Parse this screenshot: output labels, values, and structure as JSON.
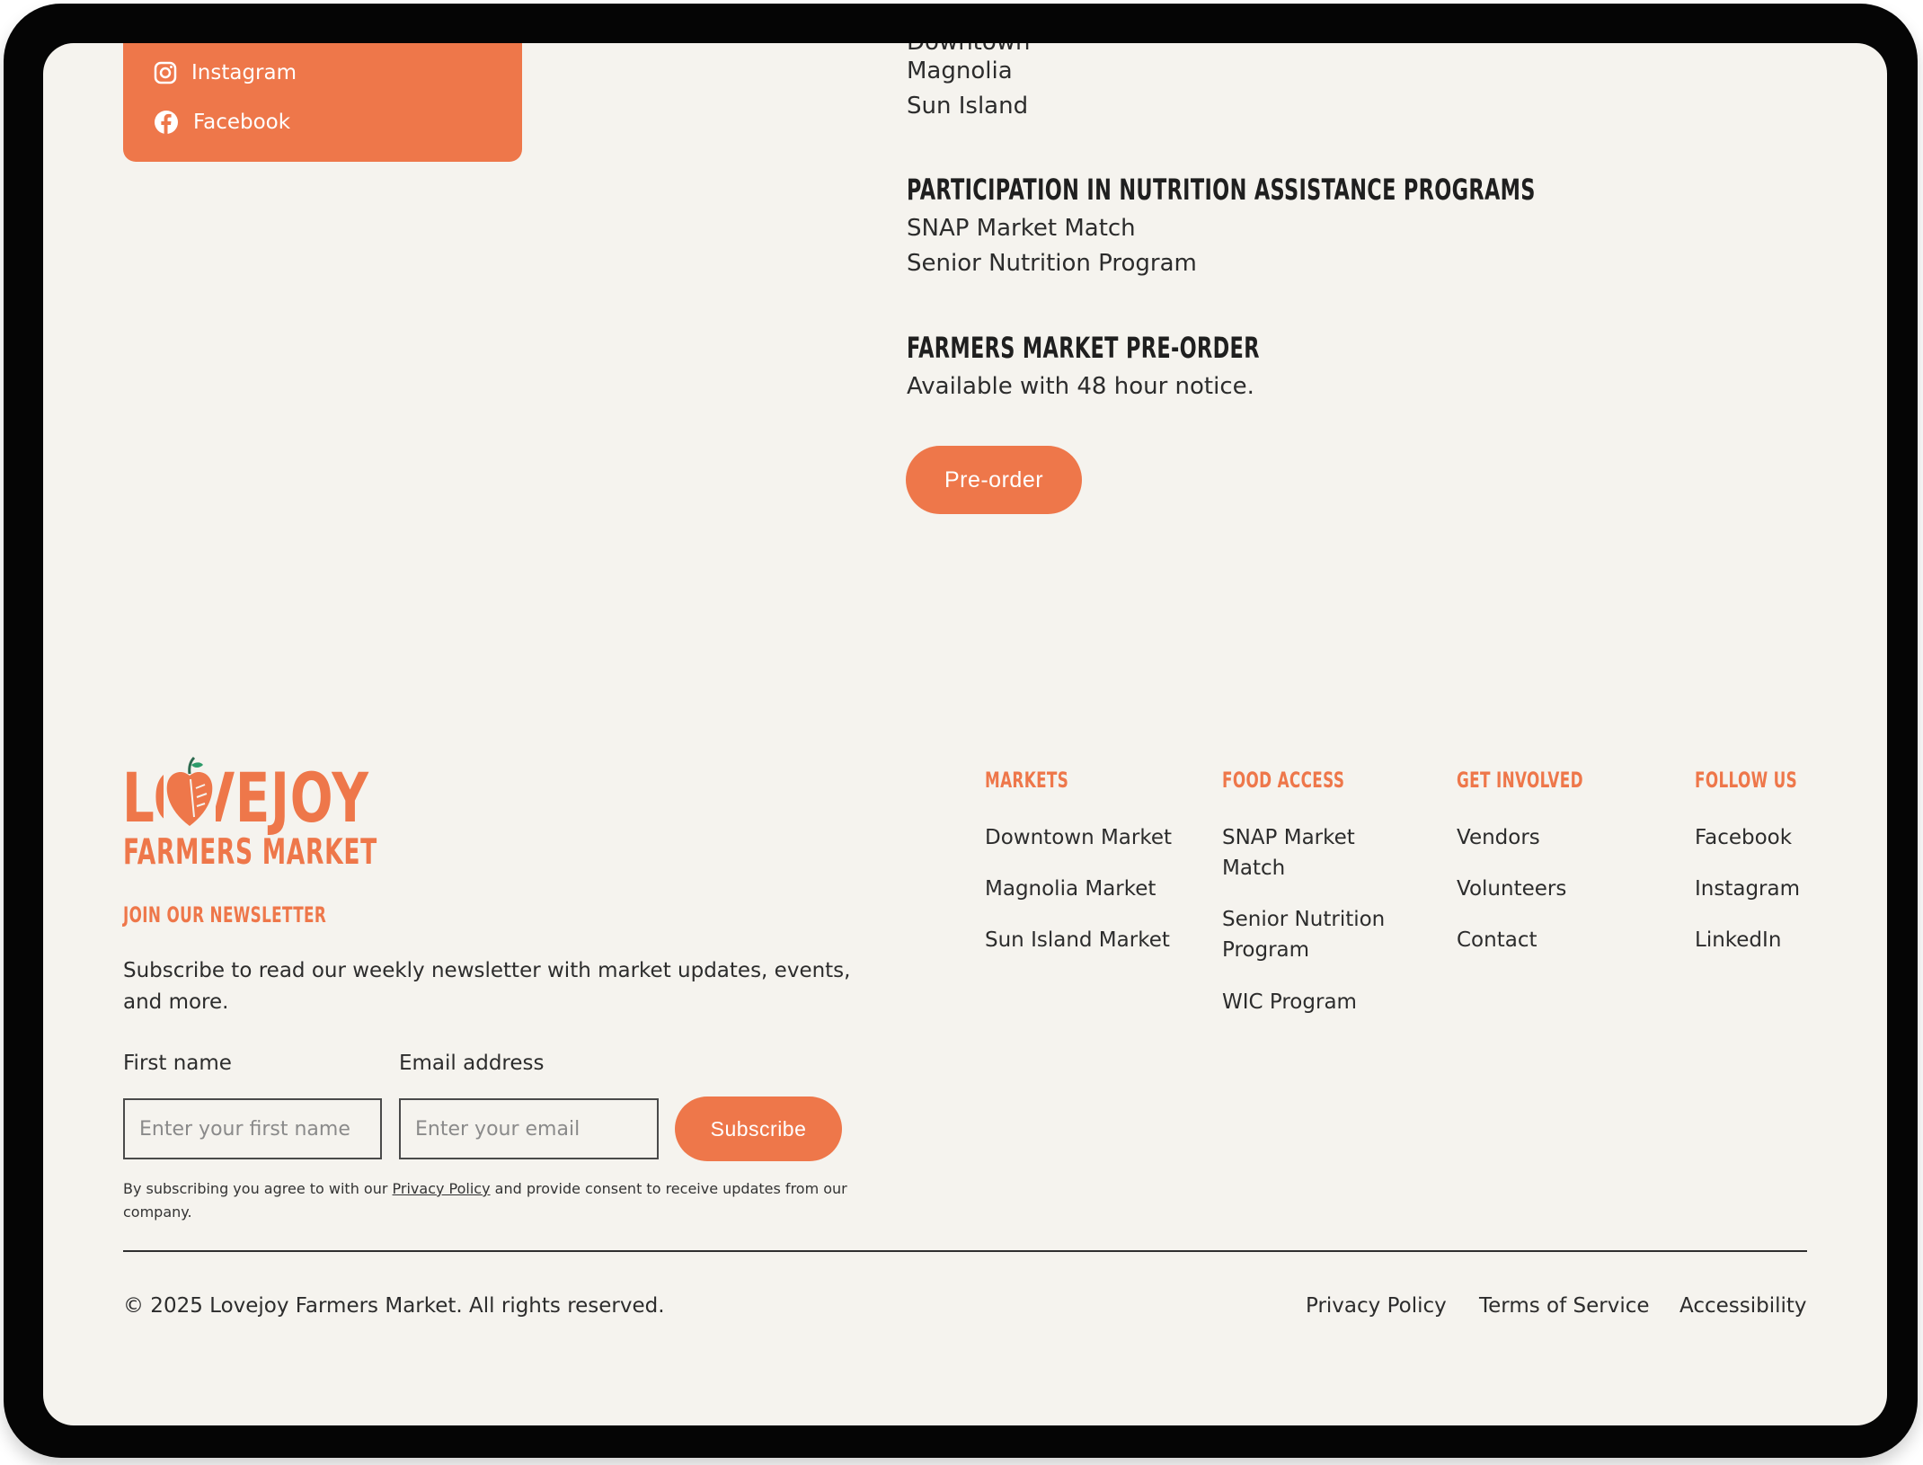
{
  "social_card": {
    "items": [
      {
        "label": "Instagram",
        "icon": "instagram-icon"
      },
      {
        "label": "Facebook",
        "icon": "facebook-icon"
      }
    ]
  },
  "locations": {
    "partial_item": "Downtown",
    "items": [
      "Magnolia",
      "Sun Island"
    ]
  },
  "nutrition": {
    "heading": "PARTICIPATION IN NUTRITION ASSISTANCE PROGRAMS",
    "items": [
      "SNAP Market Match",
      "Senior Nutrition Program"
    ]
  },
  "preorder": {
    "heading": "FARMERS MARKET PRE-ORDER",
    "text": "Available with 48 hour notice.",
    "button_label": "Pre-order"
  },
  "logo": {
    "line1": "LOVEJOY",
    "line2": "FARMERS MARKET",
    "icon": "apple-icon"
  },
  "newsletter": {
    "heading": "JOIN OUR NEWSLETTER",
    "description": "Subscribe to read our weekly newsletter with market updates, events, and more.",
    "first_name_label": "First name",
    "first_name_placeholder": "Enter your first name",
    "email_label": "Email address",
    "email_placeholder": "Enter your email",
    "subscribe_label": "Subscribe",
    "consent_before": "By subscribing you agree to with our ",
    "consent_link": "Privacy Policy",
    "consent_after": " and provide consent to receive updates from our company."
  },
  "footer_columns": {
    "markets": {
      "heading": "MARKETS",
      "links": [
        "Downtown Market",
        "Magnolia Market",
        "Sun Island Market"
      ]
    },
    "food_access": {
      "heading": "FOOD ACCESS",
      "links": [
        "SNAP Market Match",
        "Senior Nutrition Program",
        "WIC Program"
      ]
    },
    "get_involved": {
      "heading": "GET INVOLVED",
      "links": [
        "Vendors",
        "Volunteers",
        "Contact"
      ]
    },
    "follow_us": {
      "heading": "FOLLOW US",
      "links": [
        "Facebook",
        "Instagram",
        "LinkedIn"
      ]
    }
  },
  "bottom_bar": {
    "copyright": "© 2025 Lovejoy Farmers Market. All rights reserved.",
    "links": [
      "Privacy Policy",
      "Terms of Service",
      "Accessibility"
    ]
  },
  "colors": {
    "accent": "#ee774a",
    "background": "#f5f3ee",
    "text": "#2c2c2c",
    "bezel": "#050505"
  }
}
